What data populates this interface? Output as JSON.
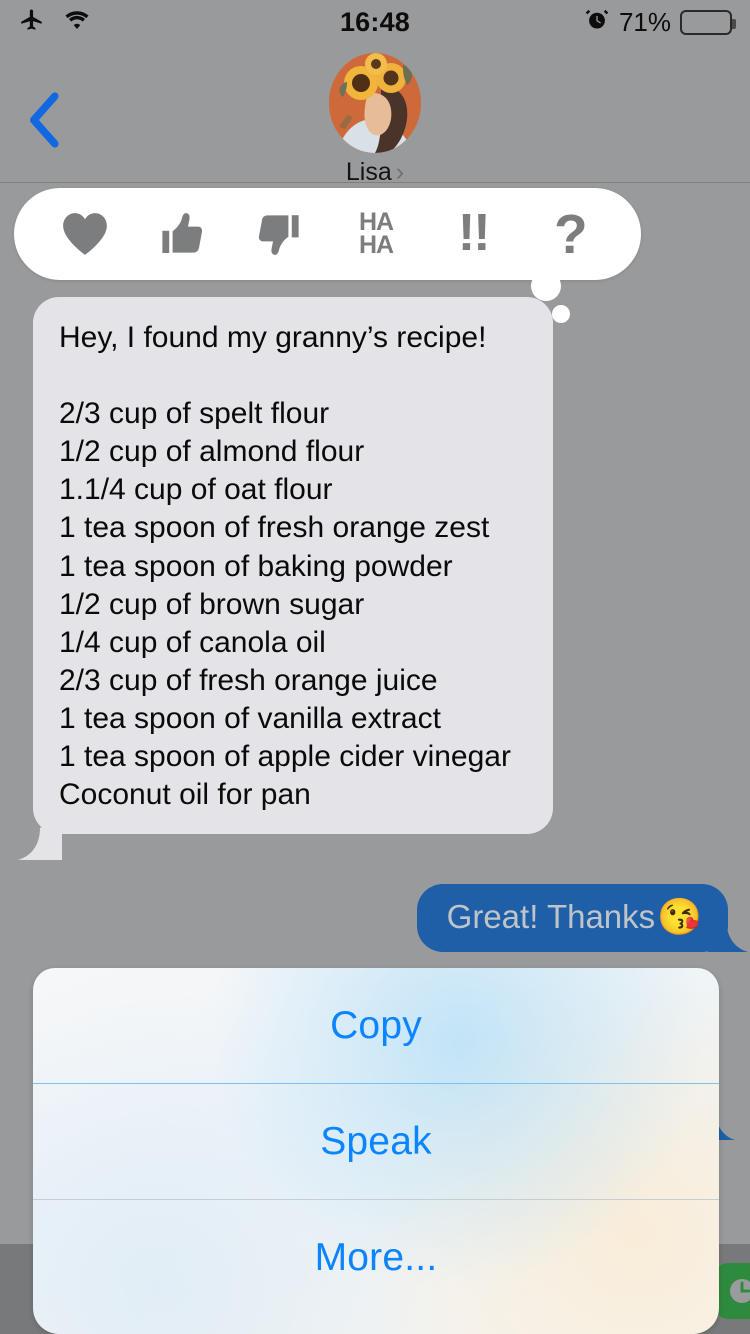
{
  "status_bar": {
    "airplane_icon": "airplane-icon",
    "wifi_icon": "wifi-icon",
    "time": "16:48",
    "alarm_icon": "alarm-icon",
    "battery_percent": "71%",
    "battery_level": 71
  },
  "nav_header": {
    "back_icon": "chevron-left-icon",
    "contact_name": "Lisa",
    "contact_chevron": "›",
    "avatar_alt": "sunflower-portrait-avatar"
  },
  "tapback_bar": {
    "items": [
      {
        "name": "heart",
        "glyph": "♥",
        "kind": "glyph"
      },
      {
        "name": "thumbs-up",
        "glyph": "",
        "kind": "svg"
      },
      {
        "name": "thumbs-down",
        "glyph": "",
        "kind": "svg"
      },
      {
        "name": "haha",
        "glyph": "HA\nHA",
        "kind": "text"
      },
      {
        "name": "exclamation",
        "glyph": "!!",
        "kind": "text"
      },
      {
        "name": "question",
        "glyph": "?",
        "kind": "text"
      }
    ]
  },
  "conversation": {
    "incoming_message": {
      "sender": "Lisa",
      "text": "Hey, I found my granny’s recipe!\n\n2/3 cup of spelt flour\n1/2 cup of almond flour\n1.1/4 cup of oat flour\n1 tea spoon of fresh orange zest\n1 tea spoon of baking powder\n1/2 cup of brown sugar\n1/4 cup of canola oil\n2/3 cup of fresh orange juice\n1 tea spoon of vanilla extract\n1 tea spoon of apple cider vinegar\nCoconut oil for pan",
      "lines": [
        "Hey, I found my granny’s recipe!",
        "",
        "2/3 cup of spelt flour",
        "1/2 cup of almond flour",
        "1.1/4 cup of oat flour",
        "1 tea spoon of fresh orange zest",
        "1 tea spoon of baking powder",
        "1/2 cup of brown sugar",
        "1/4 cup of canola oil",
        "2/3 cup of fresh orange juice",
        "1 tea spoon of vanilla extract",
        "1 tea spoon of apple cider vinegar",
        "Coconut oil for pan"
      ]
    },
    "outgoing_message": {
      "text": "Great! Thanks",
      "emoji": "😘"
    }
  },
  "action_sheet": {
    "items": [
      {
        "label": "Copy"
      },
      {
        "label": "Speak"
      },
      {
        "label": "More..."
      }
    ]
  },
  "background_elements": {
    "app_icon_clock": "clock-app-icon"
  },
  "colors": {
    "background": "#999a9b",
    "incoming_bubble": "#e4e4e8",
    "outgoing_bubble": "#1f5fa8",
    "action_link": "#0a84ff",
    "tapback_icon": "#7c7d7e",
    "back_chevron": "#1268e0"
  }
}
